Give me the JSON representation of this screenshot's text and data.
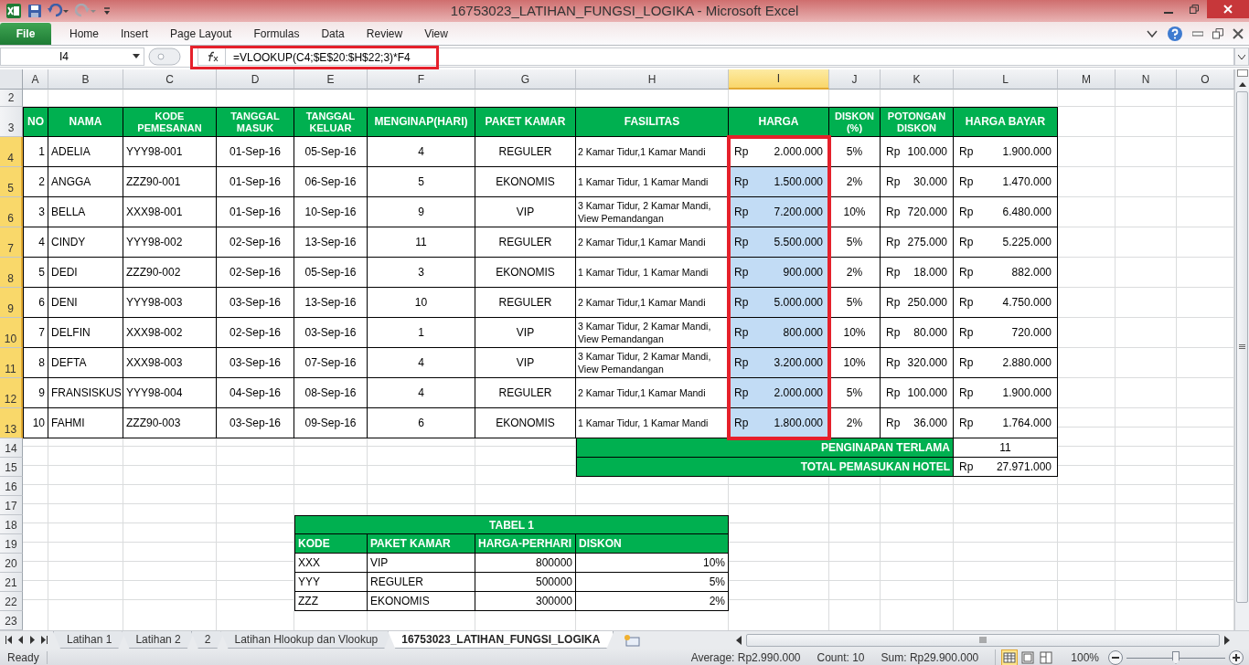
{
  "window": {
    "title": "16753023_LATIHAN_FUNGSI_LOGIKA  -  Microsoft Excel"
  },
  "ribbon": {
    "file_button": "File",
    "tabs": [
      "Home",
      "Insert",
      "Page Layout",
      "Formulas",
      "Data",
      "Review",
      "View"
    ]
  },
  "formula_bar": {
    "name_box": "I4",
    "formula": "=VLOOKUP(C4;$E$20:$H$22;3)*F4"
  },
  "columns": [
    {
      "label": "A",
      "selected": false
    },
    {
      "label": "B",
      "selected": false
    },
    {
      "label": "C",
      "selected": false
    },
    {
      "label": "D",
      "selected": false
    },
    {
      "label": "E",
      "selected": false
    },
    {
      "label": "F",
      "selected": false
    },
    {
      "label": "G",
      "selected": false
    },
    {
      "label": "H",
      "selected": false
    },
    {
      "label": "I",
      "selected": true
    },
    {
      "label": "J",
      "selected": false
    },
    {
      "label": "K",
      "selected": false
    },
    {
      "label": "L",
      "selected": false
    },
    {
      "label": "M",
      "selected": false
    },
    {
      "label": "N",
      "selected": false
    },
    {
      "label": "O",
      "selected": false
    }
  ],
  "rows": [
    {
      "label": "2",
      "selected": false
    },
    {
      "label": "3",
      "selected": false
    },
    {
      "label": "4",
      "selected": true
    },
    {
      "label": "5",
      "selected": true
    },
    {
      "label": "6",
      "selected": true
    },
    {
      "label": "7",
      "selected": true
    },
    {
      "label": "8",
      "selected": true
    },
    {
      "label": "9",
      "selected": true
    },
    {
      "label": "10",
      "selected": true
    },
    {
      "label": "11",
      "selected": true
    },
    {
      "label": "12",
      "selected": true
    },
    {
      "label": "13",
      "selected": true
    },
    {
      "label": "14",
      "selected": false
    },
    {
      "label": "15",
      "selected": false
    },
    {
      "label": "16",
      "selected": false
    },
    {
      "label": "17",
      "selected": false
    },
    {
      "label": "18",
      "selected": false
    },
    {
      "label": "19",
      "selected": false
    },
    {
      "label": "20",
      "selected": false
    },
    {
      "label": "21",
      "selected": false
    },
    {
      "label": "22",
      "selected": false
    },
    {
      "label": "23",
      "selected": false
    }
  ],
  "main_table": {
    "headers": [
      "NO",
      "NAMA",
      "KODE PEMESANAN",
      "TANGGAL MASUK",
      "TANGGAL KELUAR",
      "MENGINAP(HARI)",
      "PAKET KAMAR",
      "FASILITAS",
      "HARGA",
      "DISKON (%)",
      "POTONGAN DISKON",
      "HARGA BAYAR"
    ],
    "rows": [
      {
        "no": "1",
        "nama": "ADELIA",
        "kode": "YYY98-001",
        "masuk": "01-Sep-16",
        "keluar": "05-Sep-16",
        "hari": "4",
        "paket": "REGULER",
        "fasilitas": "2 Kamar Tidur,1 Kamar Mandi",
        "harga": {
          "currency": "Rp",
          "amount": "2.000.000"
        },
        "harga_selected": true,
        "harga_active": true,
        "diskon": "5%",
        "potongan": {
          "currency": "Rp",
          "amount": "100.000"
        },
        "bayar": {
          "currency": "Rp",
          "amount": "1.900.000"
        }
      },
      {
        "no": "2",
        "nama": "ANGGA",
        "kode": "ZZZ90-001",
        "masuk": "01-Sep-16",
        "keluar": "06-Sep-16",
        "hari": "5",
        "paket": "EKONOMIS",
        "fasilitas": "1 Kamar Tidur, 1 Kamar Mandi",
        "harga": {
          "currency": "Rp",
          "amount": "1.500.000"
        },
        "harga_selected": true,
        "harga_active": false,
        "diskon": "2%",
        "potongan": {
          "currency": "Rp",
          "amount": "30.000"
        },
        "bayar": {
          "currency": "Rp",
          "amount": "1.470.000"
        }
      },
      {
        "no": "3",
        "nama": "BELLA",
        "kode": "XXX98-001",
        "masuk": "01-Sep-16",
        "keluar": "10-Sep-16",
        "hari": "9",
        "paket": "VIP",
        "fasilitas": "3 Kamar Tidur, 2 Kamar Mandi, View Pemandangan",
        "harga": {
          "currency": "Rp",
          "amount": "7.200.000"
        },
        "harga_selected": true,
        "harga_active": false,
        "diskon": "10%",
        "potongan": {
          "currency": "Rp",
          "amount": "720.000"
        },
        "bayar": {
          "currency": "Rp",
          "amount": "6.480.000"
        }
      },
      {
        "no": "4",
        "nama": "CINDY",
        "kode": "YYY98-002",
        "masuk": "02-Sep-16",
        "keluar": "13-Sep-16",
        "hari": "11",
        "paket": "REGULER",
        "fasilitas": "2 Kamar Tidur,1 Kamar Mandi",
        "harga": {
          "currency": "Rp",
          "amount": "5.500.000"
        },
        "harga_selected": true,
        "harga_active": false,
        "diskon": "5%",
        "potongan": {
          "currency": "Rp",
          "amount": "275.000"
        },
        "bayar": {
          "currency": "Rp",
          "amount": "5.225.000"
        }
      },
      {
        "no": "5",
        "nama": "DEDI",
        "kode": "ZZZ90-002",
        "masuk": "02-Sep-16",
        "keluar": "05-Sep-16",
        "hari": "3",
        "paket": "EKONOMIS",
        "fasilitas": "1 Kamar Tidur, 1 Kamar Mandi",
        "harga": {
          "currency": "Rp",
          "amount": "900.000"
        },
        "harga_selected": true,
        "harga_active": false,
        "diskon": "2%",
        "potongan": {
          "currency": "Rp",
          "amount": "18.000"
        },
        "bayar": {
          "currency": "Rp",
          "amount": "882.000"
        }
      },
      {
        "no": "6",
        "nama": "DENI",
        "kode": "YYY98-003",
        "masuk": "03-Sep-16",
        "keluar": "13-Sep-16",
        "hari": "10",
        "paket": "REGULER",
        "fasilitas": "2 Kamar Tidur,1 Kamar Mandi",
        "harga": {
          "currency": "Rp",
          "amount": "5.000.000"
        },
        "harga_selected": true,
        "harga_active": false,
        "diskon": "5%",
        "potongan": {
          "currency": "Rp",
          "amount": "250.000"
        },
        "bayar": {
          "currency": "Rp",
          "amount": "4.750.000"
        }
      },
      {
        "no": "7",
        "nama": "DELFIN",
        "kode": "XXX98-002",
        "masuk": "02-Sep-16",
        "keluar": "03-Sep-16",
        "hari": "1",
        "paket": "VIP",
        "fasilitas": "3 Kamar Tidur, 2 Kamar Mandi, View Pemandangan",
        "harga": {
          "currency": "Rp",
          "amount": "800.000"
        },
        "harga_selected": true,
        "harga_active": false,
        "diskon": "10%",
        "potongan": {
          "currency": "Rp",
          "amount": "80.000"
        },
        "bayar": {
          "currency": "Rp",
          "amount": "720.000"
        }
      },
      {
        "no": "8",
        "nama": "DEFTA",
        "kode": "XXX98-003",
        "masuk": "03-Sep-16",
        "keluar": "07-Sep-16",
        "hari": "4",
        "paket": "VIP",
        "fasilitas": "3 Kamar Tidur, 2 Kamar Mandi, View Pemandangan",
        "harga": {
          "currency": "Rp",
          "amount": "3.200.000"
        },
        "harga_selected": true,
        "harga_active": false,
        "diskon": "10%",
        "potongan": {
          "currency": "Rp",
          "amount": "320.000"
        },
        "bayar": {
          "currency": "Rp",
          "amount": "2.880.000"
        }
      },
      {
        "no": "9",
        "nama": "FRANSISKUS",
        "kode": "YYY98-004",
        "masuk": "04-Sep-16",
        "keluar": "08-Sep-16",
        "hari": "4",
        "paket": "REGULER",
        "fasilitas": "2 Kamar Tidur,1 Kamar Mandi",
        "harga": {
          "currency": "Rp",
          "amount": "2.000.000"
        },
        "harga_selected": true,
        "harga_active": false,
        "diskon": "5%",
        "potongan": {
          "currency": "Rp",
          "amount": "100.000"
        },
        "bayar": {
          "currency": "Rp",
          "amount": "1.900.000"
        }
      },
      {
        "no": "10",
        "nama": "FAHMI",
        "kode": "ZZZ90-003",
        "masuk": "03-Sep-16",
        "keluar": "09-Sep-16",
        "hari": "6",
        "paket": "EKONOMIS",
        "fasilitas": "1 Kamar Tidur, 1 Kamar Mandi",
        "harga": {
          "currency": "Rp",
          "amount": "1.800.000"
        },
        "harga_selected": true,
        "harga_active": false,
        "diskon": "2%",
        "potongan": {
          "currency": "Rp",
          "amount": "36.000"
        },
        "bayar": {
          "currency": "Rp",
          "amount": "1.764.000"
        }
      }
    ],
    "summary": [
      {
        "label": "PENGINAPAN TERLAMA",
        "value": "11"
      },
      {
        "label": "TOTAL PEMASUKAN HOTEL",
        "currency": "Rp",
        "value": "27.971.000"
      }
    ]
  },
  "tabel_1": {
    "title": "TABEL 1",
    "headers": [
      "KODE",
      "PAKET KAMAR",
      "HARGA-PERHARI",
      "DISKON"
    ],
    "rows": [
      {
        "kode": "XXX",
        "paket": "VIP",
        "harga": "800000",
        "diskon": "10%"
      },
      {
        "kode": "YYY",
        "paket": "REGULER",
        "harga": "500000",
        "diskon": "5%"
      },
      {
        "kode": "ZZZ",
        "paket": "EKONOMIS",
        "harga": "300000",
        "diskon": "2%"
      }
    ]
  },
  "sheet_tabs": [
    {
      "label": "Latihan 1",
      "selected": false
    },
    {
      "label": "Latihan 2",
      "selected": false
    },
    {
      "label": "2",
      "selected": false
    },
    {
      "label": "Latihan Hlookup dan Vlookup",
      "selected": false
    },
    {
      "label": "16753023_LATIHAN_FUNGSI_LOGIKA",
      "selected": true
    }
  ],
  "status_bar": {
    "mode": "Ready",
    "average": "Average:  Rp2.990.000",
    "count": "Count: 10",
    "sum": "Sum:  Rp29.900.000",
    "views": [
      {
        "kind": "normal",
        "selected": true
      },
      {
        "kind": "page_layout",
        "selected": false
      },
      {
        "kind": "page_break",
        "selected": false
      }
    ],
    "zoom": {
      "reading": "100%",
      "level": 0.5
    }
  }
}
